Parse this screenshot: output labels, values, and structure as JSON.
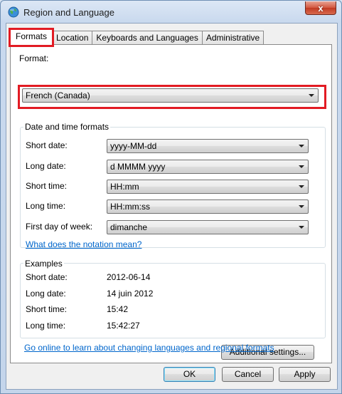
{
  "window": {
    "title": "Region and Language",
    "icon": "globe-icon",
    "close_glyph": "x"
  },
  "tabs": [
    {
      "label": "Formats",
      "active": true
    },
    {
      "label": "Location",
      "active": false
    },
    {
      "label": "Keyboards and Languages",
      "active": false
    },
    {
      "label": "Administrative",
      "active": false
    }
  ],
  "format": {
    "label": "Format:",
    "value": "French (Canada)"
  },
  "date_time_formats": {
    "title": "Date and time formats",
    "rows": [
      {
        "label": "Short date:",
        "value": "yyyy-MM-dd"
      },
      {
        "label": "Long date:",
        "value": "d MMMM yyyy"
      },
      {
        "label": "Short time:",
        "value": "HH:mm"
      },
      {
        "label": "Long time:",
        "value": "HH:mm:ss"
      },
      {
        "label": "First day of week:",
        "value": "dimanche"
      }
    ],
    "notation_link": "What does the notation mean?"
  },
  "examples": {
    "title": "Examples",
    "rows": [
      {
        "label": "Short date:",
        "value": "2012-06-14"
      },
      {
        "label": "Long date:",
        "value": "14 juin 2012"
      },
      {
        "label": "Short time:",
        "value": "15:42"
      },
      {
        "label": "Long time:",
        "value": "15:42:27"
      }
    ]
  },
  "additional_settings_label": "Additional settings...",
  "online_link": "Go online to learn about changing languages and regional formats",
  "buttons": {
    "ok": "OK",
    "cancel": "Cancel",
    "apply": "Apply"
  },
  "colors": {
    "highlight": "#e21b23",
    "link": "#0066cc"
  }
}
